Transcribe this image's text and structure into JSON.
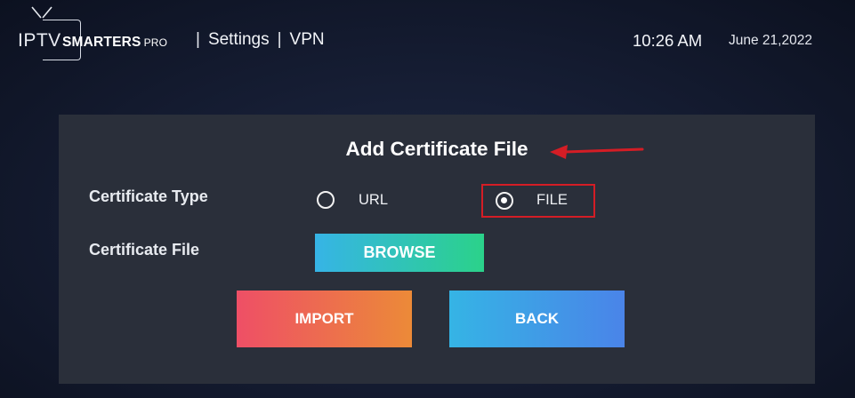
{
  "app": {
    "logo_iptv": "IPTV",
    "logo_smarters": "SMARTERS",
    "logo_pro": "PRO",
    "breadcrumb": [
      "Settings",
      "VPN"
    ],
    "breadcrumb_separator": "|",
    "time": "10:26 AM",
    "date": "June 21,2022"
  },
  "dialog": {
    "title": "Add Certificate File",
    "certificate_type_label": "Certificate Type",
    "options": [
      {
        "label": "URL",
        "selected": false
      },
      {
        "label": "FILE",
        "selected": true
      }
    ],
    "certificate_file_label": "Certificate File",
    "browse_label": "BROWSE",
    "import_label": "IMPORT",
    "back_label": "BACK"
  },
  "colors": {
    "background": "#141b30",
    "panel": "#2a2f3a",
    "highlight": "#d41d25",
    "browse_gradient": [
      "#36b4e6",
      "#2bd28a"
    ],
    "import_gradient": [
      "#ee4f66",
      "#ec8a38"
    ],
    "back_gradient": [
      "#35b4e5",
      "#4a84e8"
    ]
  },
  "icons": [
    "tv-antenna-icon",
    "arrow-left-icon",
    "radio-unchecked-icon",
    "radio-checked-icon"
  ]
}
